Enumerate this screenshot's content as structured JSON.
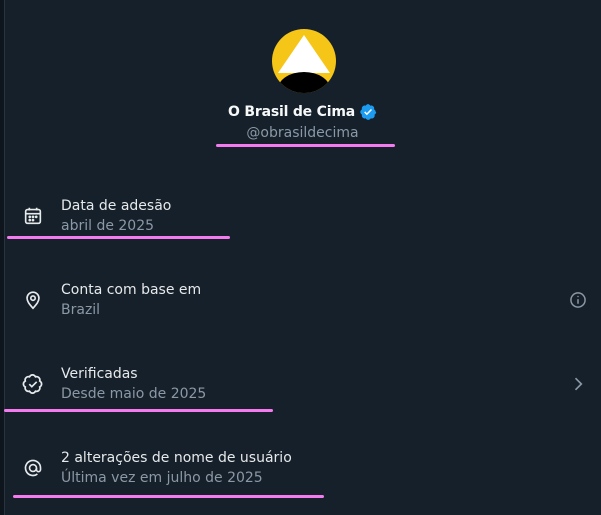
{
  "profile": {
    "display_name": "O Brasil de Cima",
    "handle": "@obrasildecima"
  },
  "rows": [
    {
      "icon": "calendar-icon",
      "title": "Data de adesão",
      "subtitle": "abril de 2025"
    },
    {
      "icon": "location-pin-icon",
      "title": "Conta com base em",
      "subtitle": "Brazil",
      "trailing_icon": "info-icon"
    },
    {
      "icon": "verified-badge-icon",
      "title": "Verificadas",
      "subtitle": "Desde maio de 2025",
      "trailing_icon": "chevron-right-icon"
    },
    {
      "icon": "at-sign-icon",
      "title": "2 alterações de nome de usuário",
      "subtitle": "Última vez em julho de 2025"
    }
  ],
  "colors": {
    "background": "#15202b",
    "primary_text": "#e7e9ea",
    "secondary_text": "#8b98a5",
    "verified_blue": "#1d9bf0",
    "highlight_underline": "#f37bef",
    "avatar_yellow": "#f5c518"
  }
}
